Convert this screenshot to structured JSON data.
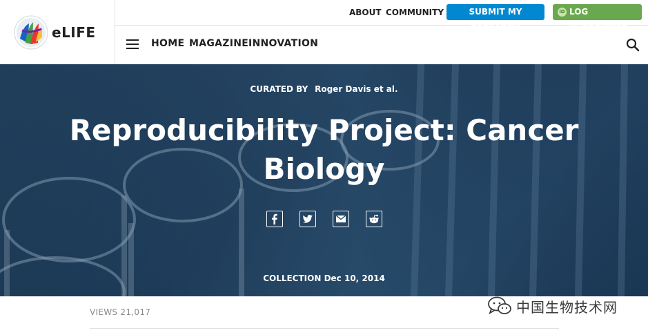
{
  "brand": {
    "logo_text": "eLIFE"
  },
  "top_nav": {
    "about": "ABOUT",
    "community": "COMMUNITY",
    "submit": "SUBMIT MY RESEARCH",
    "login": "LOG IN/REGISTER",
    "orcid_badge": "iD"
  },
  "main_nav": {
    "items": [
      "HOME",
      "MAGAZINE",
      "INNOVATION"
    ]
  },
  "hero": {
    "curated_label": "CURATED BY",
    "curator": "Roger Davis et al.",
    "title": "Reproducibility Project: Cancer Biology",
    "share": [
      "facebook",
      "twitter",
      "email",
      "reddit"
    ],
    "collection_label": "COLLECTION",
    "collection_date": "Dec 10, 2014"
  },
  "stats": {
    "views": "VIEWS 21,017"
  },
  "watermark": {
    "text": "中国生物技术网"
  },
  "colors": {
    "submit": "#0288d1",
    "login": "#6aa84f",
    "hero": "#234563"
  }
}
